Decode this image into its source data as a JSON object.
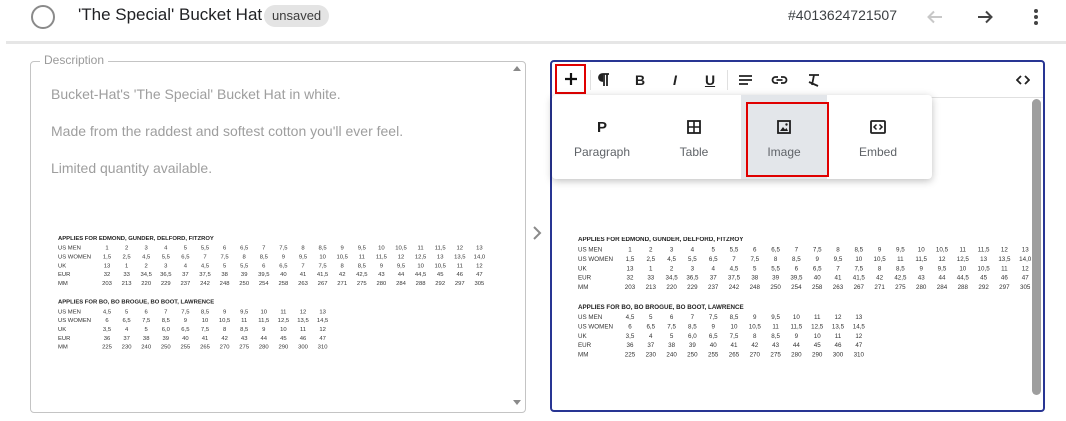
{
  "header": {
    "title": "'The Special' Bucket Hat",
    "status_badge": "unsaved",
    "product_id": "#4013624721507"
  },
  "description": {
    "legend": "Description",
    "paragraphs": [
      "Bucket-Hat's 'The Special' Bucket Hat in white.",
      "Made from the raddest and softest cotton you'll ever feel.",
      "Limited quantity available."
    ]
  },
  "size_chart": {
    "tables": [
      {
        "title": "APPLIES FOR EDMOND, GUNDER, DELFORD, FITZROY",
        "rows": [
          {
            "label": "US MEN",
            "values": [
              "1",
              "2",
              "3",
              "4",
              "5",
              "5,5",
              "6",
              "6,5",
              "7",
              "7,5",
              "8",
              "8,5",
              "9",
              "9,5",
              "10",
              "10,5",
              "11",
              "11,5",
              "12",
              "13"
            ]
          },
          {
            "label": "US WOMEN",
            "values": [
              "1,5",
              "2,5",
              "4,5",
              "5,5",
              "6,5",
              "7",
              "7,5",
              "8",
              "8,5",
              "9",
              "9,5",
              "10",
              "10,5",
              "11",
              "11,5",
              "12",
              "12,5",
              "13",
              "13,5",
              "14,0"
            ]
          },
          {
            "label": "UK",
            "values": [
              "13",
              "1",
              "2",
              "3",
              "4",
              "4,5",
              "5",
              "5,5",
              "6",
              "6,5",
              "7",
              "7,5",
              "8",
              "8,5",
              "9",
              "9,5",
              "10",
              "10,5",
              "11",
              "12"
            ]
          },
          {
            "label": "EUR",
            "values": [
              "32",
              "33",
              "34,5",
              "36,5",
              "37",
              "37,5",
              "38",
              "39",
              "39,5",
              "40",
              "41",
              "41,5",
              "42",
              "42,5",
              "43",
              "44",
              "44,5",
              "45",
              "46",
              "47"
            ]
          },
          {
            "label": "MM",
            "values": [
              "203",
              "213",
              "220",
              "229",
              "237",
              "242",
              "248",
              "250",
              "254",
              "258",
              "263",
              "267",
              "271",
              "275",
              "280",
              "284",
              "288",
              "292",
              "297",
              "305"
            ]
          }
        ]
      },
      {
        "title": "APPLIES FOR BO, BO BROGUE, BO BOOT, LAWRENCE",
        "rows": [
          {
            "label": "US MEN",
            "values": [
              "4,5",
              "5",
              "6",
              "7",
              "7,5",
              "8,5",
              "9",
              "9,5",
              "10",
              "11",
              "12",
              "13"
            ]
          },
          {
            "label": "US WOMEN",
            "values": [
              "6",
              "6,5",
              "7,5",
              "8,5",
              "9",
              "10",
              "10,5",
              "11",
              "11,5",
              "12,5",
              "13,5",
              "14,5"
            ]
          },
          {
            "label": "UK",
            "values": [
              "3,5",
              "4",
              "5",
              "6,0",
              "6,5",
              "7,5",
              "8",
              "8,5",
              "9",
              "10",
              "11",
              "12"
            ]
          },
          {
            "label": "EUR",
            "values": [
              "36",
              "37",
              "38",
              "39",
              "40",
              "41",
              "42",
              "43",
              "44",
              "45",
              "46",
              "47"
            ]
          },
          {
            "label": "MM",
            "values": [
              "225",
              "230",
              "240",
              "250",
              "255",
              "265",
              "270",
              "275",
              "280",
              "290",
              "300",
              "310"
            ]
          }
        ]
      }
    ]
  },
  "insert_menu": {
    "items": [
      {
        "icon": "P",
        "label": "Paragraph"
      },
      {
        "icon": "table-icon",
        "label": "Table"
      },
      {
        "icon": "image-icon",
        "label": "Image"
      },
      {
        "icon": "embed-icon",
        "label": "Embed"
      }
    ],
    "selected": "Image"
  },
  "toolbar": {
    "bold_label": "B",
    "italic_label": "I",
    "underline_label": "U"
  },
  "colors": {
    "editor_border": "#283593",
    "highlight_red": "#e00000",
    "badge_bg": "#e4e4e4"
  }
}
